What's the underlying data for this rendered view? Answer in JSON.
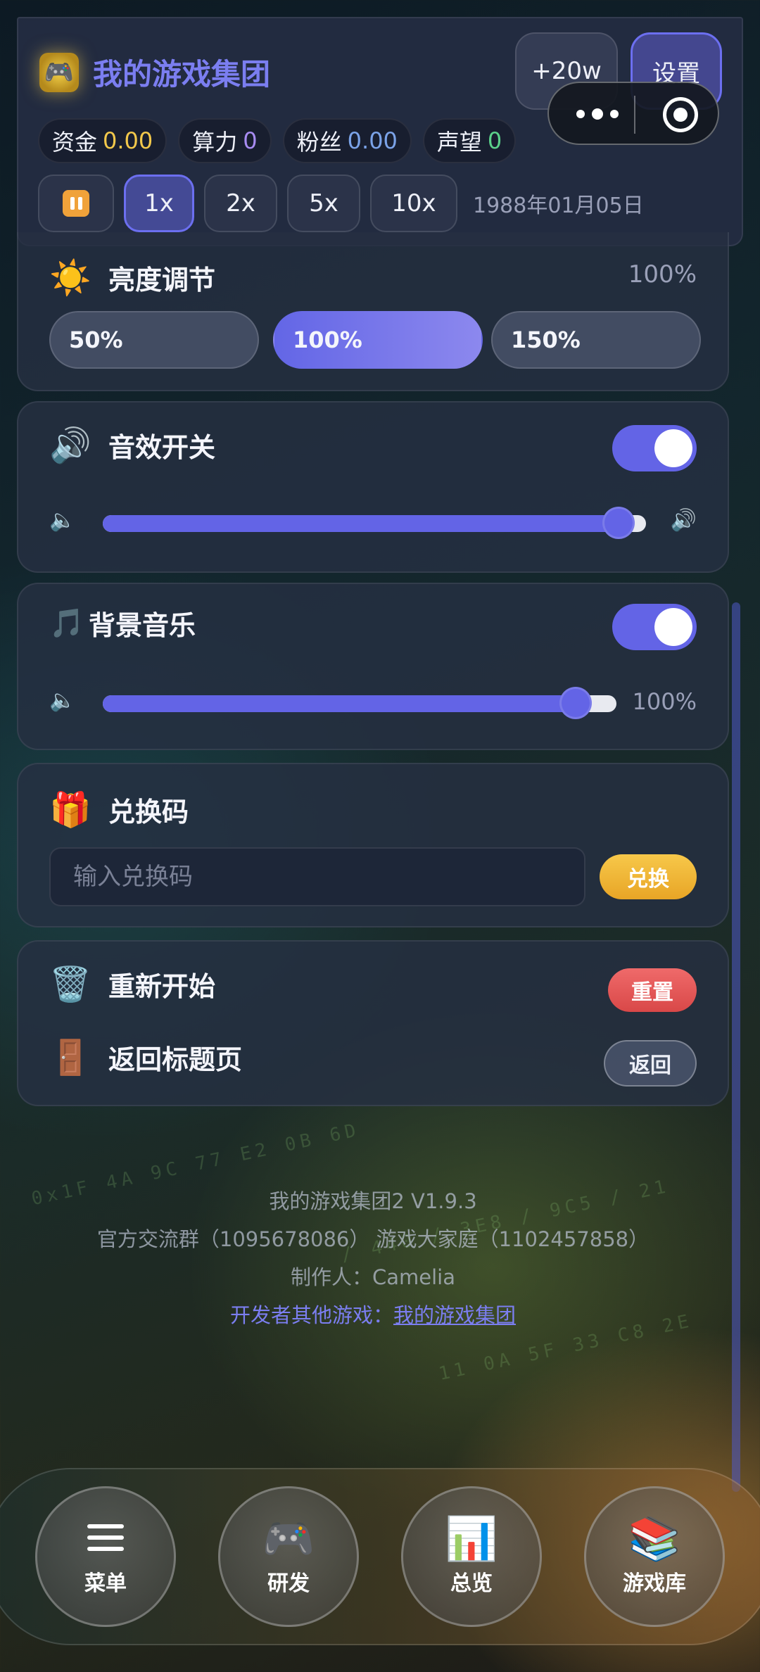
{
  "header": {
    "title": "我的游戏集团",
    "bonus_button": "+20w",
    "settings_button": "设置",
    "stats": [
      {
        "label": "资金",
        "value": "0.00"
      },
      {
        "label": "算力",
        "value": "0"
      },
      {
        "label": "粉丝",
        "value": "0.00"
      },
      {
        "label": "声望",
        "value": "0"
      }
    ],
    "speeds": [
      "1x",
      "2x",
      "5x",
      "10x"
    ],
    "date": "1988年01月05日"
  },
  "brightness": {
    "title": "亮度调节",
    "current": "100%",
    "options": [
      "50%",
      "100%",
      "150%"
    ],
    "selected": "100%"
  },
  "sound": {
    "title": "音效开关",
    "enabled": true,
    "volume": 0.95
  },
  "music": {
    "title": "背景音乐",
    "enabled": true,
    "volume": 0.92,
    "value_label": "100%"
  },
  "redeem": {
    "title": "兑换码",
    "placeholder": "输入兑换码",
    "button": "兑换"
  },
  "actions": {
    "restart_label": "重新开始",
    "reset_button": "重置",
    "back_label": "返回标题页",
    "back_button": "返回"
  },
  "footer": {
    "version": "我的游戏集团2 V1.9.3",
    "groups": "官方交流群（1095678086） 游戏大家庭（1102457858）",
    "author": "制作人：Camelia",
    "dev_prefix": "开发者其他游戏：",
    "dev_link": "我的游戏集团"
  },
  "nav": [
    {
      "label": "菜单",
      "icon": "menu-icon"
    },
    {
      "label": "研发",
      "icon": "gamepad-icon"
    },
    {
      "label": "总览",
      "icon": "chart-icon"
    },
    {
      "label": "游戏库",
      "icon": "books-icon"
    }
  ],
  "colors": {
    "accent": "#6364e6",
    "gold": "#f2c84b",
    "danger": "#e05555"
  }
}
